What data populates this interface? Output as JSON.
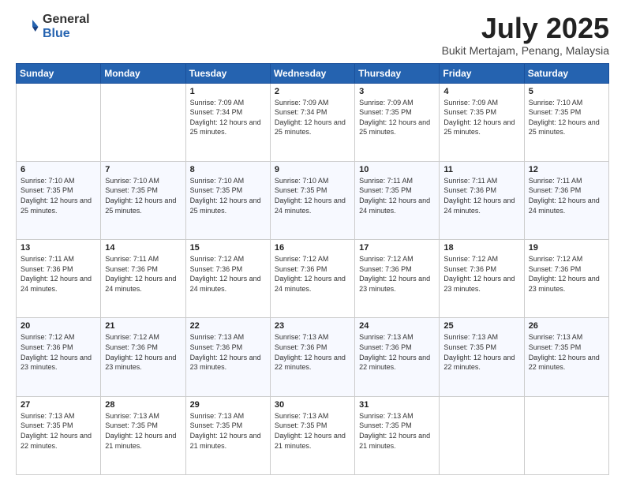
{
  "logo": {
    "general": "General",
    "blue": "Blue"
  },
  "header": {
    "month": "July 2025",
    "location": "Bukit Mertajam, Penang, Malaysia"
  },
  "weekdays": [
    "Sunday",
    "Monday",
    "Tuesday",
    "Wednesday",
    "Thursday",
    "Friday",
    "Saturday"
  ],
  "weeks": [
    [
      {
        "date": "",
        "sunrise": "",
        "sunset": "",
        "daylight": ""
      },
      {
        "date": "",
        "sunrise": "",
        "sunset": "",
        "daylight": ""
      },
      {
        "date": "1",
        "sunrise": "Sunrise: 7:09 AM",
        "sunset": "Sunset: 7:34 PM",
        "daylight": "Daylight: 12 hours and 25 minutes."
      },
      {
        "date": "2",
        "sunrise": "Sunrise: 7:09 AM",
        "sunset": "Sunset: 7:34 PM",
        "daylight": "Daylight: 12 hours and 25 minutes."
      },
      {
        "date": "3",
        "sunrise": "Sunrise: 7:09 AM",
        "sunset": "Sunset: 7:35 PM",
        "daylight": "Daylight: 12 hours and 25 minutes."
      },
      {
        "date": "4",
        "sunrise": "Sunrise: 7:09 AM",
        "sunset": "Sunset: 7:35 PM",
        "daylight": "Daylight: 12 hours and 25 minutes."
      },
      {
        "date": "5",
        "sunrise": "Sunrise: 7:10 AM",
        "sunset": "Sunset: 7:35 PM",
        "daylight": "Daylight: 12 hours and 25 minutes."
      }
    ],
    [
      {
        "date": "6",
        "sunrise": "Sunrise: 7:10 AM",
        "sunset": "Sunset: 7:35 PM",
        "daylight": "Daylight: 12 hours and 25 minutes."
      },
      {
        "date": "7",
        "sunrise": "Sunrise: 7:10 AM",
        "sunset": "Sunset: 7:35 PM",
        "daylight": "Daylight: 12 hours and 25 minutes."
      },
      {
        "date": "8",
        "sunrise": "Sunrise: 7:10 AM",
        "sunset": "Sunset: 7:35 PM",
        "daylight": "Daylight: 12 hours and 25 minutes."
      },
      {
        "date": "9",
        "sunrise": "Sunrise: 7:10 AM",
        "sunset": "Sunset: 7:35 PM",
        "daylight": "Daylight: 12 hours and 24 minutes."
      },
      {
        "date": "10",
        "sunrise": "Sunrise: 7:11 AM",
        "sunset": "Sunset: 7:35 PM",
        "daylight": "Daylight: 12 hours and 24 minutes."
      },
      {
        "date": "11",
        "sunrise": "Sunrise: 7:11 AM",
        "sunset": "Sunset: 7:36 PM",
        "daylight": "Daylight: 12 hours and 24 minutes."
      },
      {
        "date": "12",
        "sunrise": "Sunrise: 7:11 AM",
        "sunset": "Sunset: 7:36 PM",
        "daylight": "Daylight: 12 hours and 24 minutes."
      }
    ],
    [
      {
        "date": "13",
        "sunrise": "Sunrise: 7:11 AM",
        "sunset": "Sunset: 7:36 PM",
        "daylight": "Daylight: 12 hours and 24 minutes."
      },
      {
        "date": "14",
        "sunrise": "Sunrise: 7:11 AM",
        "sunset": "Sunset: 7:36 PM",
        "daylight": "Daylight: 12 hours and 24 minutes."
      },
      {
        "date": "15",
        "sunrise": "Sunrise: 7:12 AM",
        "sunset": "Sunset: 7:36 PM",
        "daylight": "Daylight: 12 hours and 24 minutes."
      },
      {
        "date": "16",
        "sunrise": "Sunrise: 7:12 AM",
        "sunset": "Sunset: 7:36 PM",
        "daylight": "Daylight: 12 hours and 24 minutes."
      },
      {
        "date": "17",
        "sunrise": "Sunrise: 7:12 AM",
        "sunset": "Sunset: 7:36 PM",
        "daylight": "Daylight: 12 hours and 23 minutes."
      },
      {
        "date": "18",
        "sunrise": "Sunrise: 7:12 AM",
        "sunset": "Sunset: 7:36 PM",
        "daylight": "Daylight: 12 hours and 23 minutes."
      },
      {
        "date": "19",
        "sunrise": "Sunrise: 7:12 AM",
        "sunset": "Sunset: 7:36 PM",
        "daylight": "Daylight: 12 hours and 23 minutes."
      }
    ],
    [
      {
        "date": "20",
        "sunrise": "Sunrise: 7:12 AM",
        "sunset": "Sunset: 7:36 PM",
        "daylight": "Daylight: 12 hours and 23 minutes."
      },
      {
        "date": "21",
        "sunrise": "Sunrise: 7:12 AM",
        "sunset": "Sunset: 7:36 PM",
        "daylight": "Daylight: 12 hours and 23 minutes."
      },
      {
        "date": "22",
        "sunrise": "Sunrise: 7:13 AM",
        "sunset": "Sunset: 7:36 PM",
        "daylight": "Daylight: 12 hours and 23 minutes."
      },
      {
        "date": "23",
        "sunrise": "Sunrise: 7:13 AM",
        "sunset": "Sunset: 7:36 PM",
        "daylight": "Daylight: 12 hours and 22 minutes."
      },
      {
        "date": "24",
        "sunrise": "Sunrise: 7:13 AM",
        "sunset": "Sunset: 7:36 PM",
        "daylight": "Daylight: 12 hours and 22 minutes."
      },
      {
        "date": "25",
        "sunrise": "Sunrise: 7:13 AM",
        "sunset": "Sunset: 7:35 PM",
        "daylight": "Daylight: 12 hours and 22 minutes."
      },
      {
        "date": "26",
        "sunrise": "Sunrise: 7:13 AM",
        "sunset": "Sunset: 7:35 PM",
        "daylight": "Daylight: 12 hours and 22 minutes."
      }
    ],
    [
      {
        "date": "27",
        "sunrise": "Sunrise: 7:13 AM",
        "sunset": "Sunset: 7:35 PM",
        "daylight": "Daylight: 12 hours and 22 minutes."
      },
      {
        "date": "28",
        "sunrise": "Sunrise: 7:13 AM",
        "sunset": "Sunset: 7:35 PM",
        "daylight": "Daylight: 12 hours and 21 minutes."
      },
      {
        "date": "29",
        "sunrise": "Sunrise: 7:13 AM",
        "sunset": "Sunset: 7:35 PM",
        "daylight": "Daylight: 12 hours and 21 minutes."
      },
      {
        "date": "30",
        "sunrise": "Sunrise: 7:13 AM",
        "sunset": "Sunset: 7:35 PM",
        "daylight": "Daylight: 12 hours and 21 minutes."
      },
      {
        "date": "31",
        "sunrise": "Sunrise: 7:13 AM",
        "sunset": "Sunset: 7:35 PM",
        "daylight": "Daylight: 12 hours and 21 minutes."
      },
      {
        "date": "",
        "sunrise": "",
        "sunset": "",
        "daylight": ""
      },
      {
        "date": "",
        "sunrise": "",
        "sunset": "",
        "daylight": ""
      }
    ]
  ]
}
